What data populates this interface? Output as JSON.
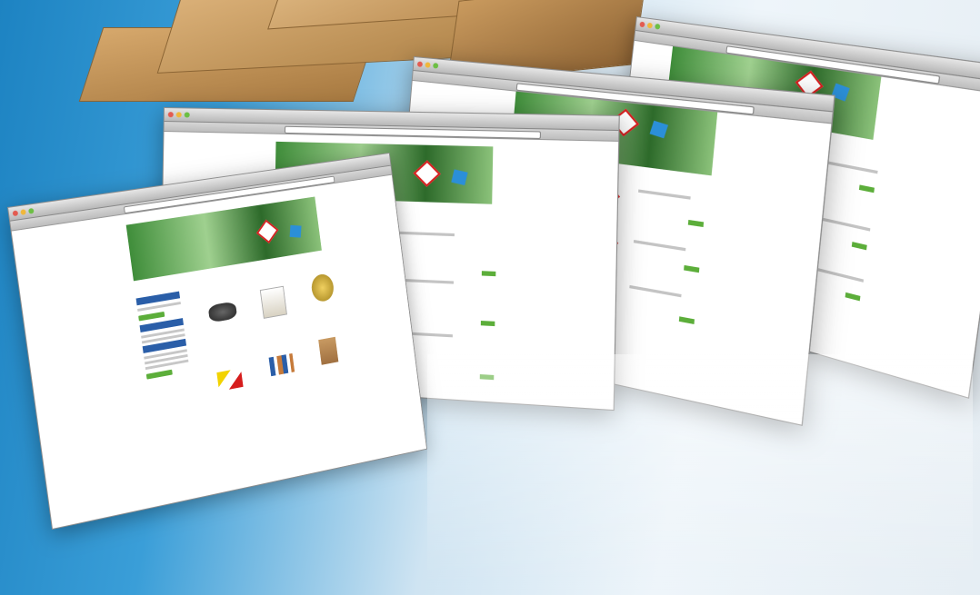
{
  "windows": {
    "w1": {
      "title": ""
    },
    "w2": {
      "title": ""
    },
    "w3": {
      "title": ""
    },
    "w4": {
      "title": ""
    }
  },
  "colors": {
    "background_blue": "#1d83c2",
    "cardboard": "#c89a62",
    "toolbar_gray": "#c8c8c8",
    "banner_green": "#3f8d3a",
    "sidebar_blue": "#2a5ea8",
    "button_green": "#5cae3a",
    "hazard_red": "#d61d1d",
    "hazard_yellow": "#f2d300"
  },
  "icons": [
    "cardboard-boxes",
    "browser-window",
    "hazard-diamond-icon",
    "flammable-icon",
    "corrosive-icon",
    "toxic-icon",
    "blue-box-icon"
  ]
}
